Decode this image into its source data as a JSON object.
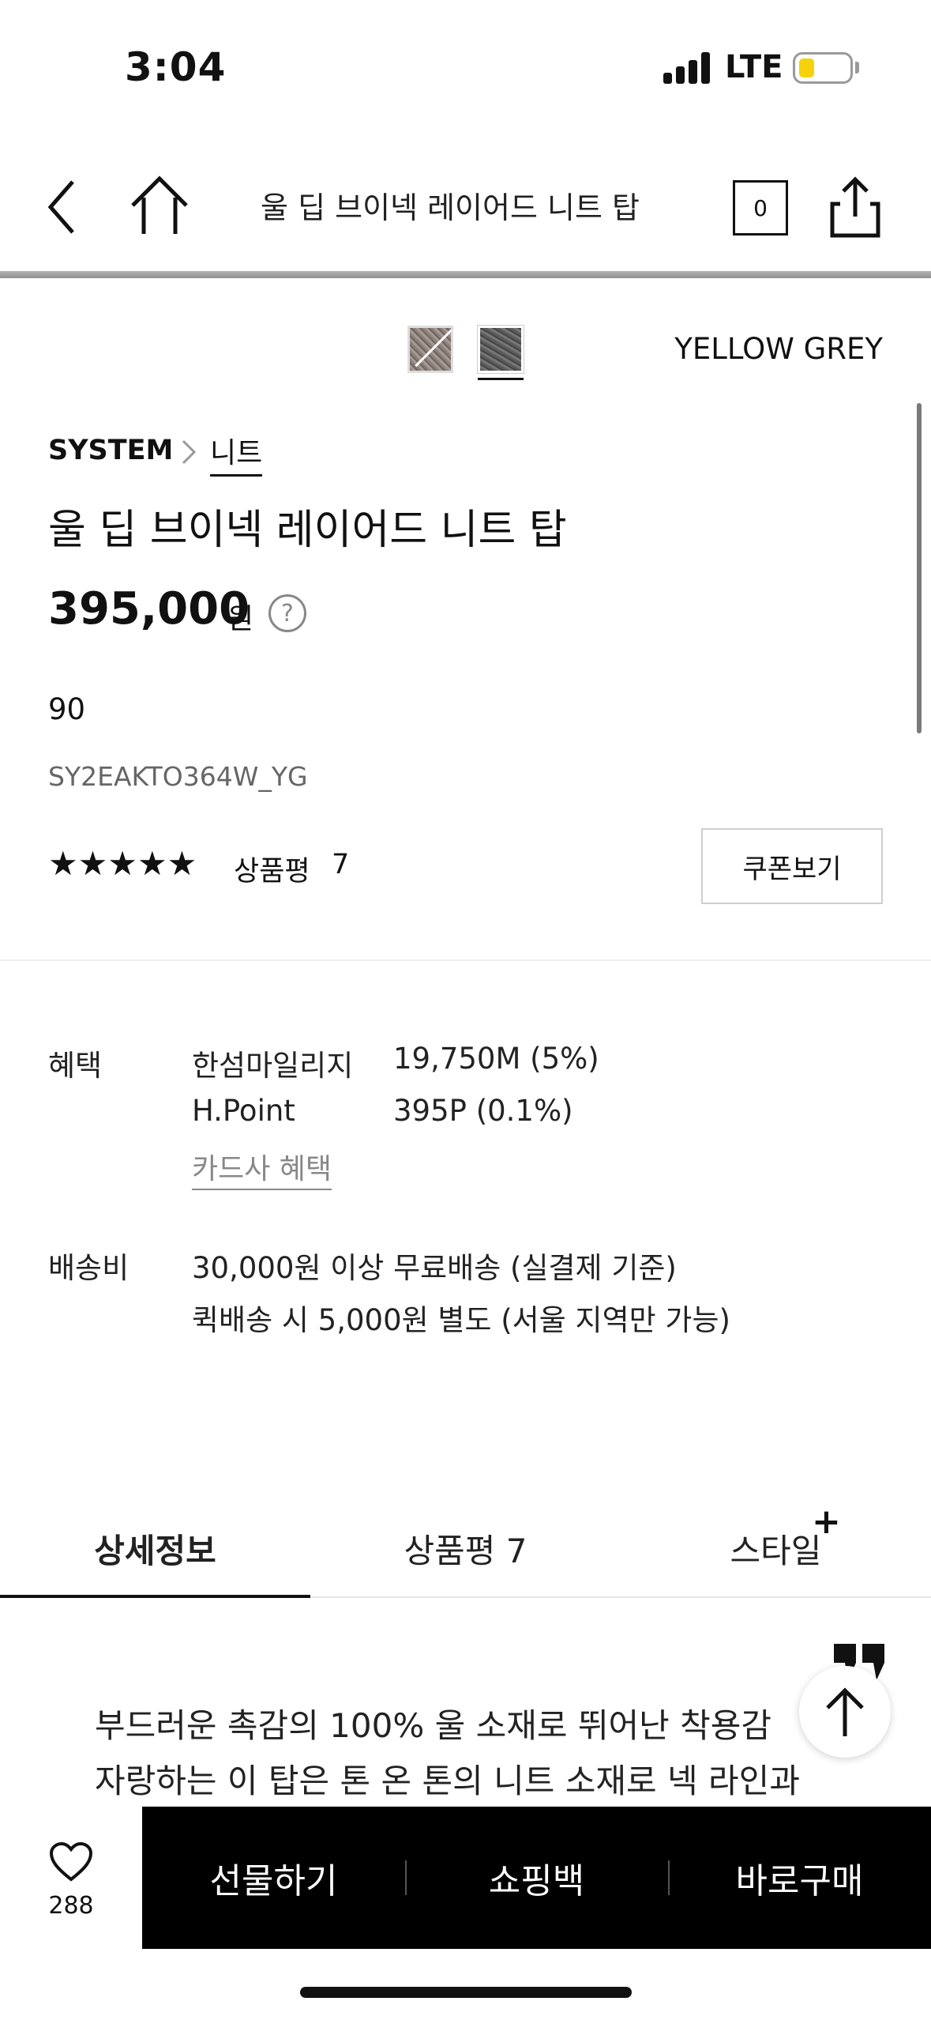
{
  "status_bar": {
    "time": "3:04",
    "network": "LTE"
  },
  "nav": {
    "title": "울 딥 브이넥 레이어드 니트 탑",
    "cart_count": "0"
  },
  "product": {
    "color_name": "YELLOW GREY",
    "brand": "SYSTEM",
    "category": "니트",
    "name": "울 딥 브이넥 레이어드 니트 탑",
    "price": "395,000",
    "price_unit": "원",
    "price_help": "?",
    "discount": "90",
    "sku": "SY2EAKTO364W_YG",
    "rating_stars": "★★★★★",
    "rating": 5,
    "review_label": "상품평",
    "review_count": "7",
    "coupon_label": "쿠폰보기"
  },
  "benefits": {
    "label": "혜택",
    "rows": [
      {
        "name": "한섬마일리지",
        "value": "19,750M (5%)"
      },
      {
        "name": "H.Point",
        "value": "395P (0.1%)"
      }
    ],
    "card_link": "카드사 혜택"
  },
  "shipping": {
    "label": "배송비",
    "lines": [
      "30,000원 이상 무료배송 (실결제 기준)",
      "퀵배송 시 5,000원 별도 (서울 지역만 가능)"
    ]
  },
  "tabs": [
    {
      "label": "상세정보",
      "active": true
    },
    {
      "label": "상품평 7",
      "active": false
    },
    {
      "label": "스타일",
      "active": false
    }
  ],
  "tab_plus": "+",
  "description": [
    "부드러운 촉감의 100% 울 소재로 뛰어난 착용감",
    "자랑하는 이 탑은 톤 온 톤의 니트 소재로 넥 라인과"
  ],
  "bottom": {
    "wish_count": "288",
    "actions": [
      "선물하기",
      "쇼핑백",
      "바로구매"
    ]
  }
}
